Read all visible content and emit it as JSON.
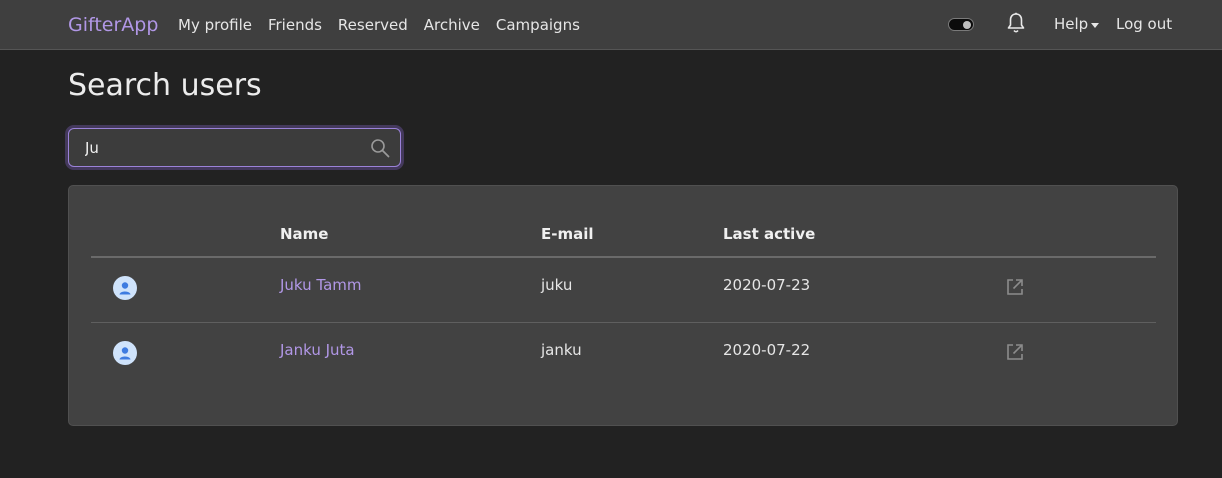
{
  "nav": {
    "brand": "GifterApp",
    "links": [
      "My profile",
      "Friends",
      "Reserved",
      "Archive",
      "Campaigns"
    ],
    "help_label": "Help",
    "logout_label": "Log out"
  },
  "page": {
    "title": "Search users"
  },
  "search": {
    "value": "Ju",
    "placeholder": ""
  },
  "table": {
    "headers": {
      "name": "Name",
      "email": "E-mail",
      "last_active": "Last active"
    },
    "rows": [
      {
        "name": "Juku Tamm",
        "email": "juku",
        "last_active": "2020-07-23"
      },
      {
        "name": "Janku Juta",
        "email": "janku",
        "last_active": "2020-07-22"
      }
    ]
  },
  "colors": {
    "accent": "#b197e6",
    "navbar_bg": "#3f3f3f",
    "page_bg": "#222222",
    "card_bg": "#424242"
  },
  "icons": [
    "theme-toggle",
    "bell-icon",
    "search-icon",
    "user-avatar-icon",
    "open-external-icon"
  ]
}
